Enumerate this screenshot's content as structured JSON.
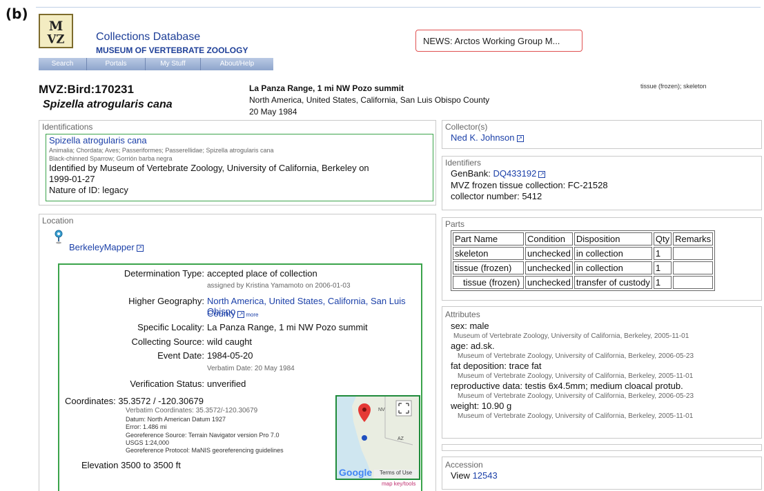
{
  "figure_label": "(b)",
  "header": {
    "db_title": "Collections Database",
    "museum": "MUSEUM OF VERTEBRATE ZOOLOGY",
    "news": "NEWS: Arctos Working Group M...",
    "nav": [
      "Search",
      "Portals",
      "My Stuff",
      "About/Help"
    ]
  },
  "record": {
    "catalog": "MVZ:Bird:170231",
    "scientific_name": "Spizella atrogularis cana",
    "locality": "La Panza Range, 1 mi NW Pozo summit",
    "geography": "North America, United States, California, San Luis Obispo County",
    "date": "20 May 1984",
    "parts_summary": "tissue (frozen); skeleton"
  },
  "identifications": {
    "title": "Identifications",
    "name": "Spizella atrogularis cana",
    "taxonomy": "Animalia; Chordata; Aves; Passeriformes; Passerellidae; Spizella atrogularis cana",
    "common": "Black-chinned Sparrow; Gorrión barba negra",
    "identified_by": "Identified by Museum of Vertebrate Zoology, University of California, Berkeley on",
    "identified_date": "1999-01-27",
    "nature": "Nature of ID: legacy"
  },
  "location": {
    "title": "Location",
    "mapper": "BerkeleyMapper",
    "det_type_label": "Determination Type:",
    "det_type": "accepted place of collection",
    "assigned": "assigned by Kristina Yamamoto on 2006-01-03",
    "higher_geo_label": "Higher Geography:",
    "higher_geo_1": "North America, United States, California, San Luis Obispo",
    "higher_geo_2": "County",
    "more": "more",
    "specific_label": "Specific Locality:",
    "specific": "La Panza Range, 1 mi NW Pozo summit",
    "source_label": "Collecting Source:",
    "source": "wild caught",
    "event_label": "Event Date:",
    "event": "1984-05-20",
    "verbatim_date": "Verbatim Date: 20 May 1984",
    "verif_label": "Verification Status:",
    "verif": "unverified",
    "coords_label": "Coordinates:",
    "coords": "35.3572 / -120.30679",
    "verbatim_coords": "Verbatim Coordinates: 35.3572/-120.30679",
    "datum": "Datum: North American Datum 1927",
    "error": "Error: 1.486 mi",
    "geo_source": "Georeference Source: Terrain Navigator version Pro 7.0",
    "usgs": "USGS 1:24,000",
    "protocol": "Georeference Protocol: MaNIS georeferencing guidelines",
    "elevation": "Elevation 3500 to 3500 ft",
    "map_google": "Google",
    "map_terms": "Terms of Use",
    "map_nv": "NV",
    "map_az": "AZ",
    "map_key": "map key/tools"
  },
  "collectors": {
    "title": "Collector(s)",
    "name": "Ned K. Johnson"
  },
  "identifiers": {
    "title": "Identifiers",
    "genbank_label": "GenBank:",
    "genbank": "DQ433192",
    "tissue": "MVZ frozen tissue collection: FC-21528",
    "collector_number": "collector number: 5412"
  },
  "parts": {
    "title": "Parts",
    "headers": [
      "Part Name",
      "Condition",
      "Disposition",
      "Qty",
      "Remarks"
    ],
    "rows": [
      [
        "skeleton",
        "unchecked",
        "in collection",
        "1",
        ""
      ],
      [
        "tissue (frozen)",
        "unchecked",
        "in collection",
        "1",
        ""
      ],
      [
        "tissue (frozen)",
        "unchecked",
        "transfer of custody",
        "1",
        ""
      ]
    ]
  },
  "attributes": {
    "title": "Attributes",
    "items": [
      {
        "v": "sex: male",
        "s": "Museum of Vertebrate Zoology, University of California, Berkeley, 2005-11-01"
      },
      {
        "v": "age: ad.sk.",
        "s": "Museum of Vertebrate Zoology, University of California, Berkeley, 2006-05-23"
      },
      {
        "v": "fat deposition: trace fat",
        "s": "Museum of Vertebrate Zoology, University of California, Berkeley, 2005-11-01"
      },
      {
        "v": "reproductive data: testis 6x4.5mm; medium cloacal protub.",
        "s": "Museum of Vertebrate Zoology, University of California, Berkeley, 2006-05-23"
      },
      {
        "v": "weight: 10.90 g",
        "s": "Museum of Vertebrate Zoology, University of California, Berkeley, 2005-11-01"
      }
    ]
  },
  "accession": {
    "title": "Accession",
    "view_label": "View",
    "number": "12543"
  },
  "colors": {
    "link": "#1a3fa8",
    "green_border": "#3aa34a",
    "news_border": "#e05050"
  }
}
